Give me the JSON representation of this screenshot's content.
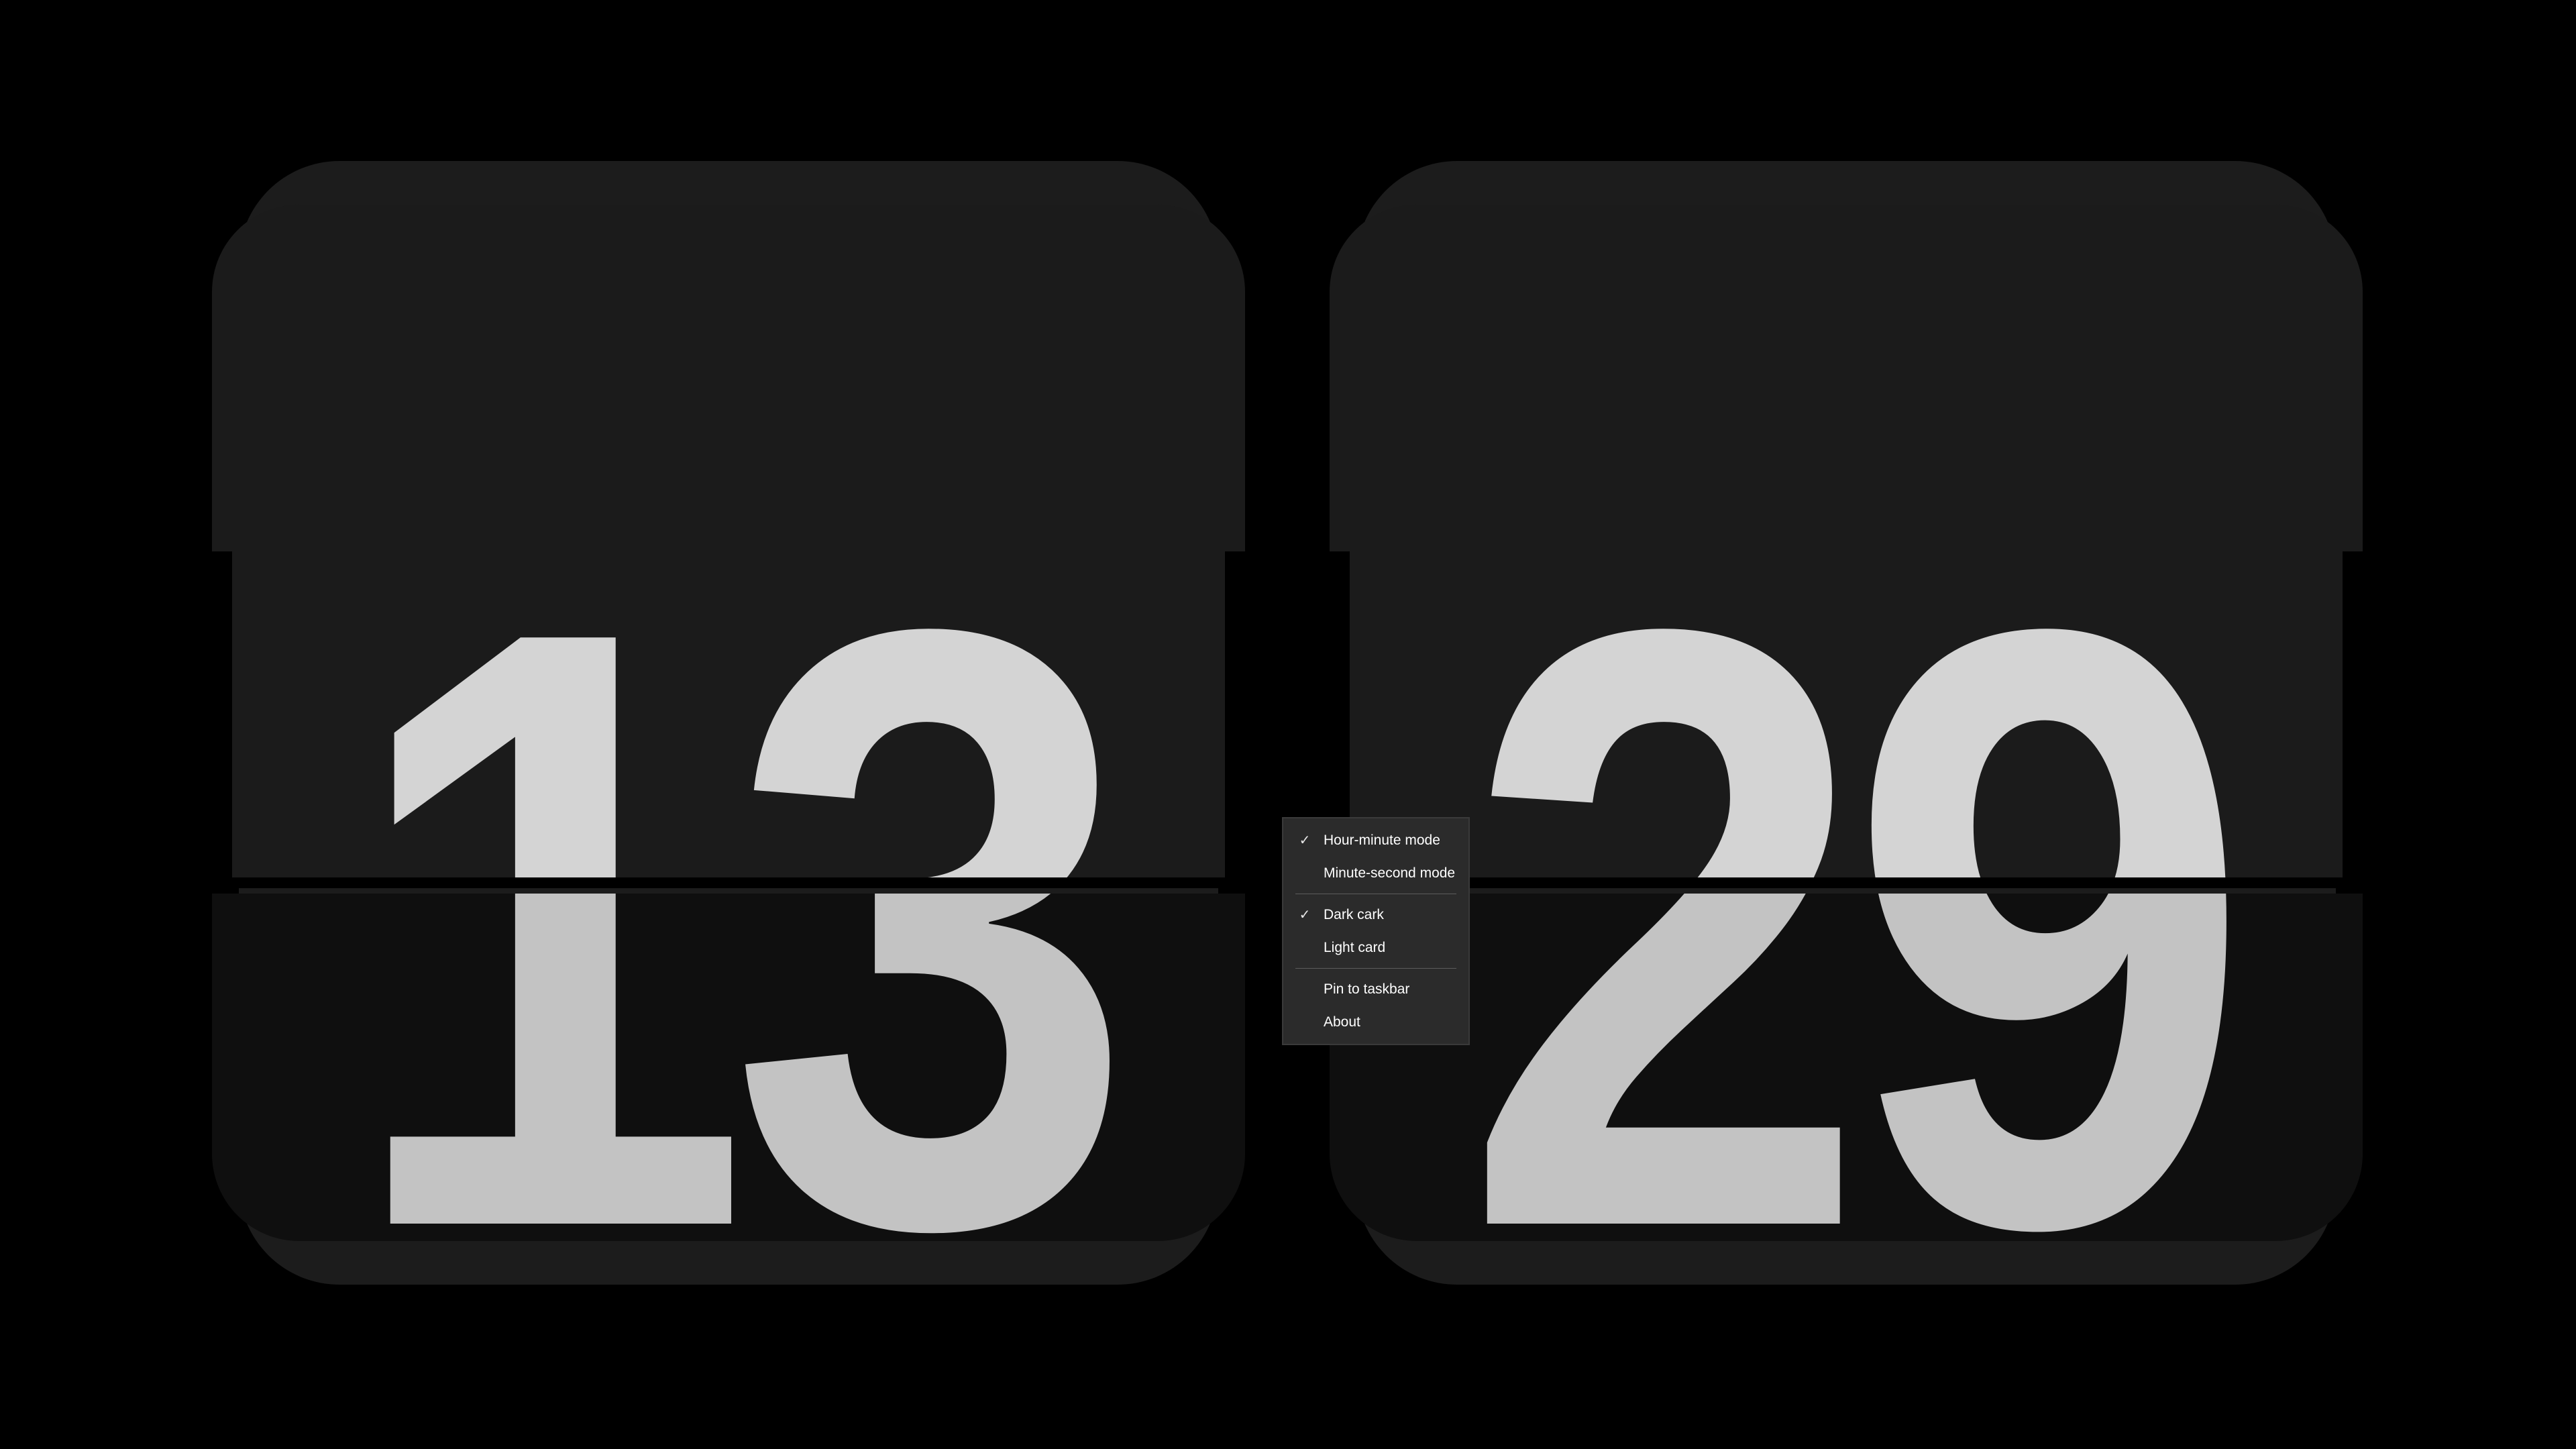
{
  "clock": {
    "hours": "13",
    "minutes": "29"
  },
  "context_menu": {
    "groups": [
      [
        {
          "label": "Hour-minute mode",
          "checked": true
        },
        {
          "label": "Minute-second mode",
          "checked": false
        }
      ],
      [
        {
          "label": "Dark cark",
          "checked": true
        },
        {
          "label": "Light card",
          "checked": false
        }
      ],
      [
        {
          "label": "Pin to taskbar",
          "checked": false
        },
        {
          "label": "About",
          "checked": false
        }
      ]
    ],
    "check_glyph": "✓"
  },
  "colors": {
    "background": "#000000",
    "card_top": "#1b1b1b",
    "card_bottom": "#0f0f0f",
    "digit_top": "#d4d4d4",
    "digit_bottom": "#c3c3c3",
    "menu_background": "#2b2b2b"
  }
}
